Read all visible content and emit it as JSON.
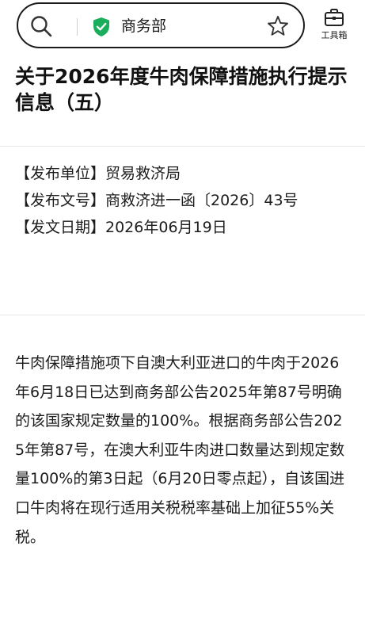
{
  "header": {
    "site_name": "商务部",
    "toolbox_label": "工具箱",
    "secure_color": "#1aad5c"
  },
  "article": {
    "title": "关于2026年度牛肉保障措施执行提示信息（五）",
    "meta": {
      "issuer": "【发布单位】贸易救济局",
      "doc_number": "【发布文号】商救济进一函〔2026〕43号",
      "date": "【发文日期】2026年06月19日"
    },
    "body": "牛肉保障措施项下自澳大利亚进口的牛肉于2026年6月18日已达到商务部公告2025年第87号明确的该国家规定数量的100%。根据商务部公告2025年第87号，在澳大利亚牛肉进口数量达到规定数量100%的第3日起（6月20日零点起），自该国进口牛肉将在现行适用关税税率基础上加征55%关税。"
  }
}
